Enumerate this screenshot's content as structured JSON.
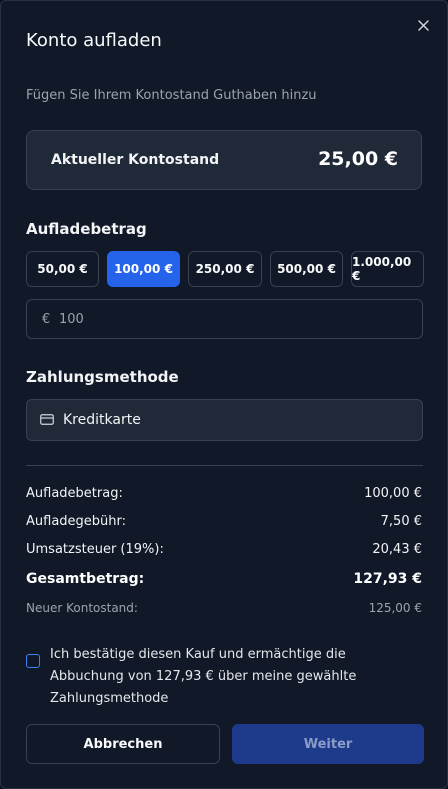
{
  "dialog": {
    "title": "Konto aufladen",
    "subtitle": "Fügen Sie Ihrem Kontostand Guthaben hinzu",
    "close_icon": "close-icon"
  },
  "balance": {
    "label": "Aktueller Kontostand",
    "value": "25,00 €"
  },
  "amount": {
    "label": "Aufladebetrag",
    "options": [
      "50,00 €",
      "100,00 €",
      "250,00 €",
      "500,00 €",
      "1.000,00 €"
    ],
    "selected": "100,00 €",
    "currency_symbol": "€",
    "input_value": "100"
  },
  "payment": {
    "label": "Zahlungsmethode",
    "method": "Kreditkarte",
    "icon": "credit-card-icon"
  },
  "summary": {
    "topup_label": "Aufladebetrag:",
    "topup_value": "100,00 €",
    "fee_label": "Aufladegebühr:",
    "fee_value": "7,50 €",
    "tax_label": "Umsatzsteuer (19%):",
    "tax_value": "20,43 €",
    "total_label": "Gesamtbetrag:",
    "total_value": "127,93 €",
    "new_balance_label": "Neuer Kontostand:",
    "new_balance_value": "125,00 €"
  },
  "confirm": {
    "text": "Ich bestätige diesen Kauf und ermächtige die Abbuchung von 127,93 € über meine gewählte Zahlungsmethode",
    "checked": false
  },
  "actions": {
    "cancel_label": "Abbrechen",
    "next_label": "Weiter"
  },
  "colors": {
    "background": "#111827",
    "accent": "#2563eb",
    "disabled_button": "#1e3a8a"
  }
}
